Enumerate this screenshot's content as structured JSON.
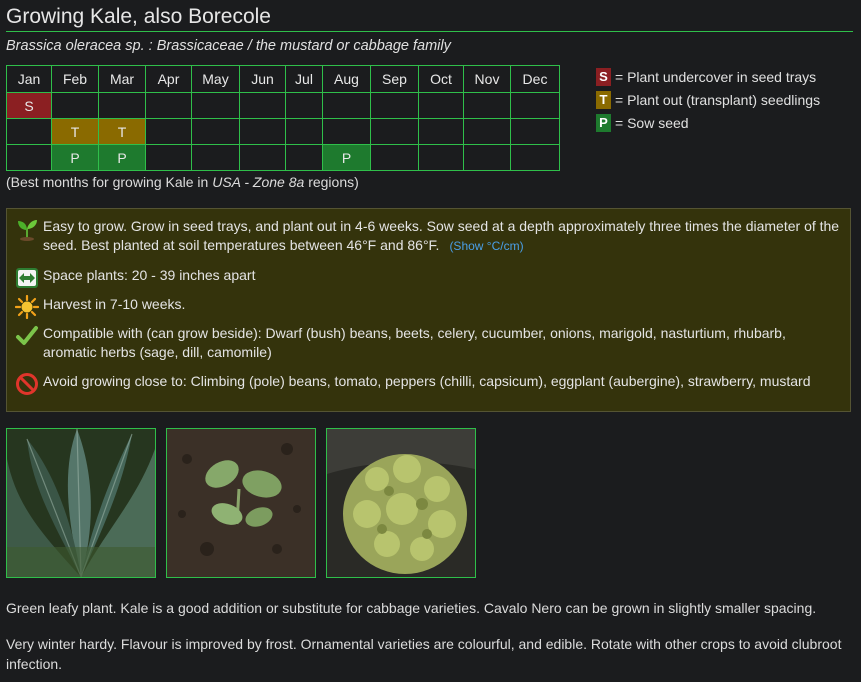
{
  "page": {
    "title": "Growing Kale, also Borecole",
    "subtitle": "Brassica oleracea sp. : Brassicaceae / the mustard or cabbage family"
  },
  "calendar": {
    "months": [
      "Jan",
      "Feb",
      "Mar",
      "Apr",
      "May",
      "Jun",
      "Jul",
      "Aug",
      "Sep",
      "Oct",
      "Nov",
      "Dec"
    ],
    "rows": [
      [
        "S",
        "",
        "",
        "",
        "",
        "",
        "",
        "",
        "",
        "",
        "",
        ""
      ],
      [
        "",
        "T",
        "T",
        "",
        "",
        "",
        "",
        "",
        "",
        "",
        "",
        ""
      ],
      [
        "",
        "P",
        "P",
        "",
        "",
        "",
        "",
        "P",
        "",
        "",
        "",
        ""
      ]
    ],
    "colors": {
      "S": "#8b1f22",
      "T": "#8a6a00",
      "P": "#1e7a2e"
    }
  },
  "legend": [
    {
      "key": "S",
      "text": "= Plant undercover in seed trays"
    },
    {
      "key": "T",
      "text": "= Plant out (transplant) seedlings"
    },
    {
      "key": "P",
      "text": "= Sow seed"
    }
  ],
  "note": {
    "prefix": "(Best months for growing Kale in ",
    "region": "USA - Zone 8a",
    "suffix": " regions)"
  },
  "info": {
    "growing": "Easy to grow. Grow in seed trays, and plant out in 4-6 weeks. Sow seed at a depth approximately three times the diameter of the seed. Best planted at soil temperatures between 46°F and 86°F.",
    "show_celsius_link": "(Show °C/cm)",
    "spacing": "Space plants: 20 - 39 inches apart",
    "harvest": "Harvest in 7-10 weeks.",
    "compatible": "Compatible with (can grow beside): Dwarf (bush) beans, beets, celery, cucumber, onions, marigold, nasturtium, rhubarb, aromatic herbs (sage, dill, camomile)",
    "avoid": "Avoid growing close to: Climbing (pole) beans, tomato, peppers (chilli, capsicum), eggplant (aubergine), strawberry, mustard"
  },
  "description": [
    "Green leafy plant. Kale is a good addition or substitute for cabbage varieties. Cavalo Nero can be grown in slightly smaller spacing.",
    "Very winter hardy. Flavour is improved by frost. Ornamental varieties are colourful, and edible. Rotate with other crops to avoid clubroot infection."
  ]
}
